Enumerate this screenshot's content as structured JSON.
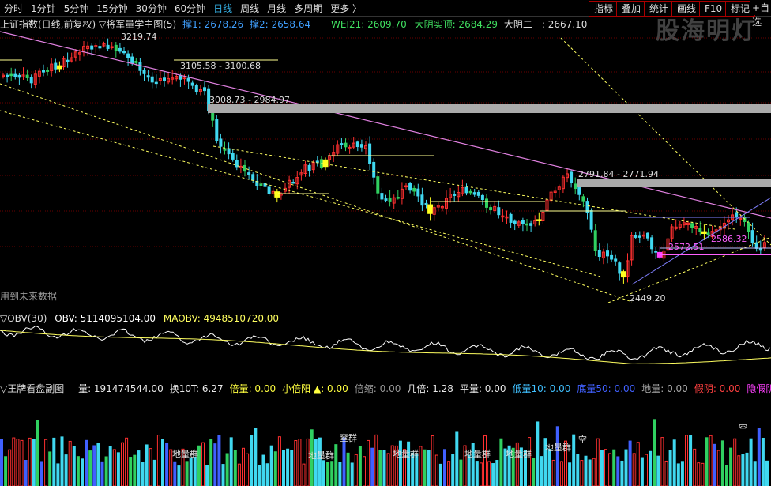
{
  "periods": [
    "分时",
    "1分钟",
    "5分钟",
    "15分钟",
    "30分钟",
    "60分钟",
    "日线",
    "周线",
    "月线",
    "多周期",
    "更多 〉"
  ],
  "active_period": "日线",
  "tools": [
    "指标",
    "叠加",
    "统计",
    "画线",
    "F10",
    "标记",
    "+自选"
  ],
  "watermark": "股海明灯",
  "main": {
    "title": "上证指数(日线,前复权) ▽将军量学主图(5)",
    "support1": "撑1: 2678.26",
    "support2": "撑2: 2658.64",
    "wei": "WEI21: 2609.70",
    "dayin": "大阴实顶: 2684.29",
    "dayin2": "大阴二一: 2667.10",
    "annotations": [
      "3219.74",
      "3105.58 - 3100.68",
      "3008.73 - 2984.97",
      "2791.84 - 2771.94",
      "2449.20",
      "2572.51",
      "2586.32"
    ],
    "future_text": "用到未来数据"
  },
  "obv": {
    "name": "▽OBV(30)",
    "obv": "OBV: 5114095104.00",
    "maobv": "MAOBV: 4948510720.00"
  },
  "vol": {
    "name": "▽王牌看盘副图",
    "fields": [
      {
        "label": "量: 191474544.00",
        "color": "#e8e8e8"
      },
      {
        "label": "换10T: 6.27",
        "color": "#e8e8e8"
      },
      {
        "label": "倍量: 0.00",
        "color": "#ffff40"
      },
      {
        "label": "小倍阳 ▲: 0.00",
        "color": "#ffff40"
      },
      {
        "label": "倍缩: 0.00",
        "color": "#999999"
      },
      {
        "label": "几倍: 1.28",
        "color": "#e8e8e8"
      },
      {
        "label": "平量: 0.00",
        "color": "#e8e8e8"
      },
      {
        "label": "低量10: 0.00",
        "color": "#40c0ff"
      },
      {
        "label": "底量50: 0.00",
        "color": "#4060ff"
      },
      {
        "label": "地量: 0.00",
        "color": "#aaaaaa"
      },
      {
        "label": "假阴: 0.00",
        "color": "#ff4040"
      },
      {
        "label": "隐假阴: 0.00",
        "color": "#ff40ff"
      }
    ],
    "marks": [
      "地量群",
      "窒群",
      "地量群",
      "地量群",
      "地量群",
      "地量群",
      "地量群",
      "空",
      "空"
    ]
  }
}
